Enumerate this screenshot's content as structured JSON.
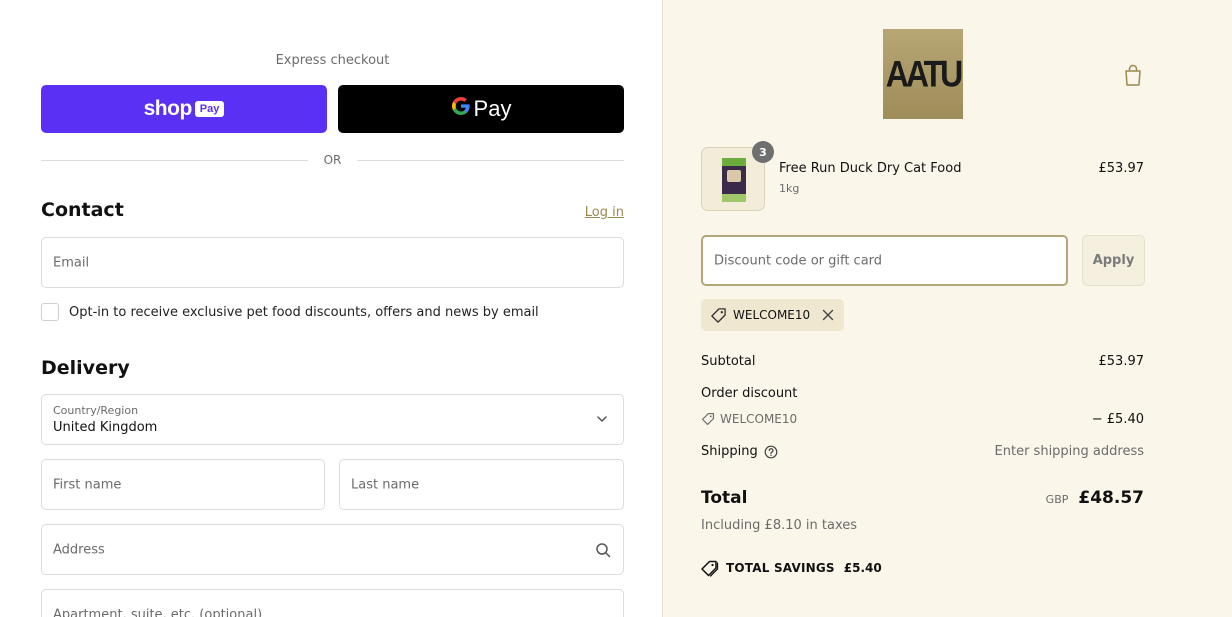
{
  "express": {
    "label": "Express checkout",
    "shop_pay": {
      "word": "shop",
      "chip": "Pay"
    },
    "gpay": {
      "g": "G",
      "word": "Pay"
    },
    "or": "OR"
  },
  "contact": {
    "heading": "Contact",
    "login": "Log in",
    "email_placeholder": "Email",
    "optin_label": "Opt-in to receive exclusive pet food discounts, offers and news by email"
  },
  "delivery": {
    "heading": "Delivery",
    "country_label": "Country/Region",
    "country_value": "United Kingdom",
    "first_name_placeholder": "First name",
    "last_name_placeholder": "Last name",
    "address_placeholder": "Address",
    "apartment_placeholder": "Apartment, suite, etc. (optional)"
  },
  "summary": {
    "logo_text": "AATU",
    "product": {
      "quantity": "3",
      "name": "Free Run Duck Dry Cat Food",
      "variant": "1kg",
      "price": "£53.97"
    },
    "discount_placeholder": "Discount code or gift card",
    "apply_label": "Apply",
    "applied_code": "WELCOME10",
    "subtotal_label": "Subtotal",
    "subtotal_value": "£53.97",
    "order_discount_label": "Order discount",
    "discount_code": "WELCOME10",
    "discount_amount": "− £5.40",
    "shipping_label": "Shipping",
    "shipping_value": "Enter shipping address",
    "total_label": "Total",
    "currency": "GBP",
    "total_amount": "£48.57",
    "taxes": "Including £8.10 in taxes",
    "savings_label": "TOTAL SAVINGS",
    "savings_amount": "£5.40"
  },
  "colors": {
    "shop_pay_purple": "#5a31f4",
    "summary_bg": "#faf6ea",
    "accent_gold": "#b4a57a"
  }
}
